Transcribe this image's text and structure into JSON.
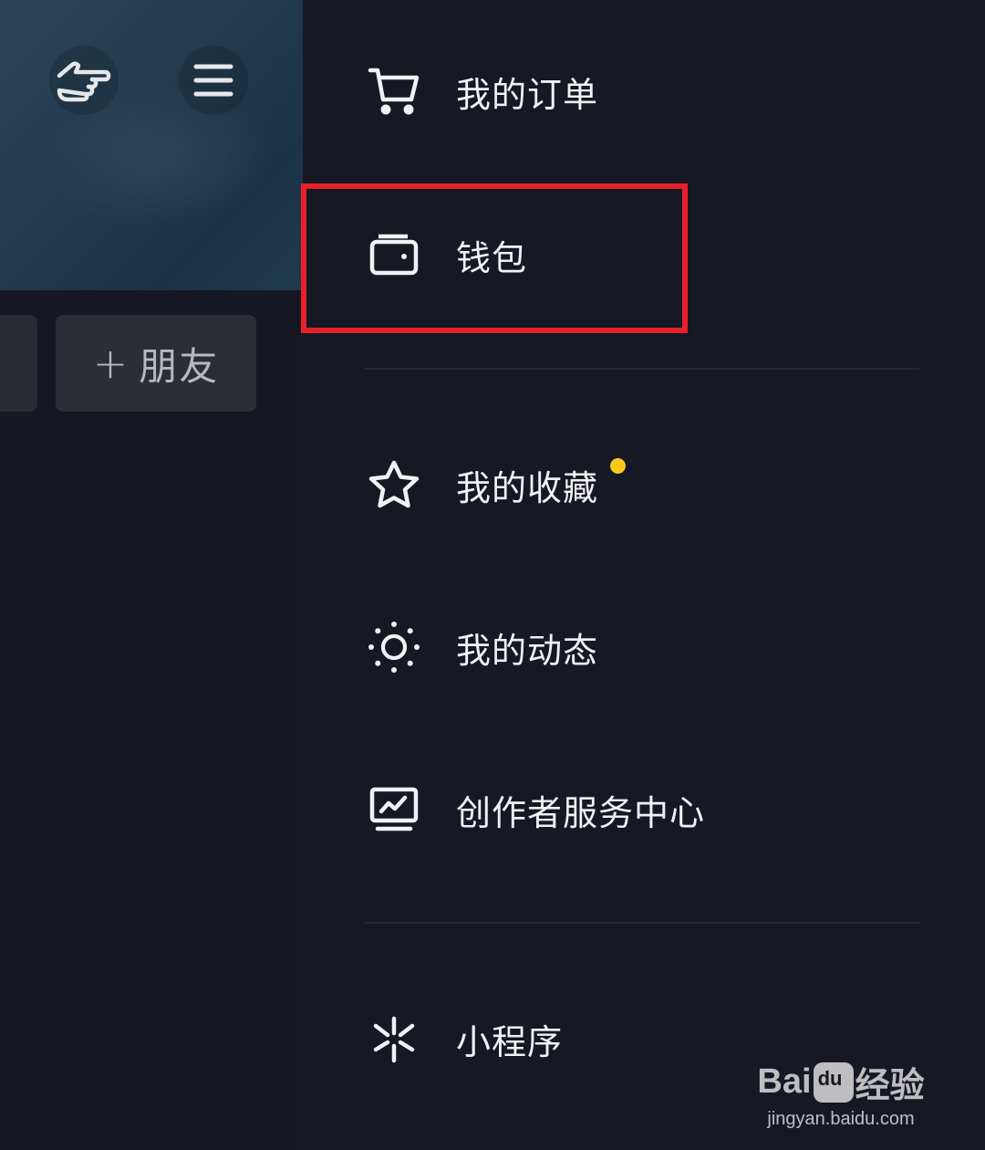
{
  "profile": {
    "add_friend": {
      "plus": "+",
      "label": "朋友"
    }
  },
  "drawer": {
    "items": [
      {
        "icon": "cart-icon",
        "label": "我的订单"
      },
      {
        "icon": "wallet-icon",
        "label": "钱包",
        "highlighted": true
      },
      {
        "icon": "star-icon",
        "label": "我的收藏",
        "badge": "dot"
      },
      {
        "icon": "sun-icon",
        "label": "我的动态"
      },
      {
        "icon": "monitor-chart-icon",
        "label": "创作者服务中心"
      },
      {
        "icon": "mini-program-icon",
        "label": "小程序"
      }
    ],
    "highlight_color": "#e8202b",
    "badge_color": "#f6c71c"
  },
  "watermark": {
    "brand_prefix": "Bai",
    "brand_suffix": "经验",
    "url": "jingyan.baidu.com"
  }
}
